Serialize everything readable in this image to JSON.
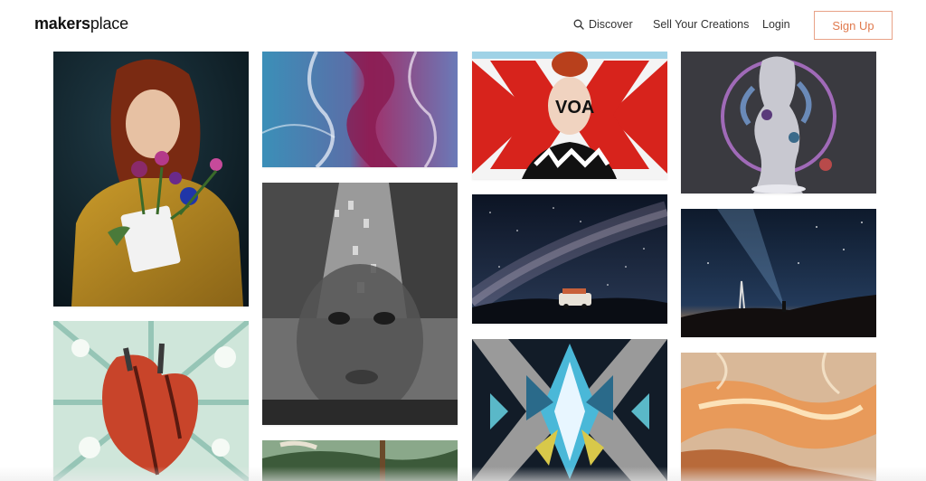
{
  "brand": {
    "logo_bold": "makers",
    "logo_light": "place"
  },
  "nav": {
    "discover_label": "Discover",
    "sell_label": "Sell Your Creations",
    "login_label": "Login",
    "signup_label": "Sign Up"
  },
  "colors": {
    "accent": "#e07a4e",
    "accent_border": "#e8a287"
  },
  "icons": {
    "search": "search-icon"
  }
}
